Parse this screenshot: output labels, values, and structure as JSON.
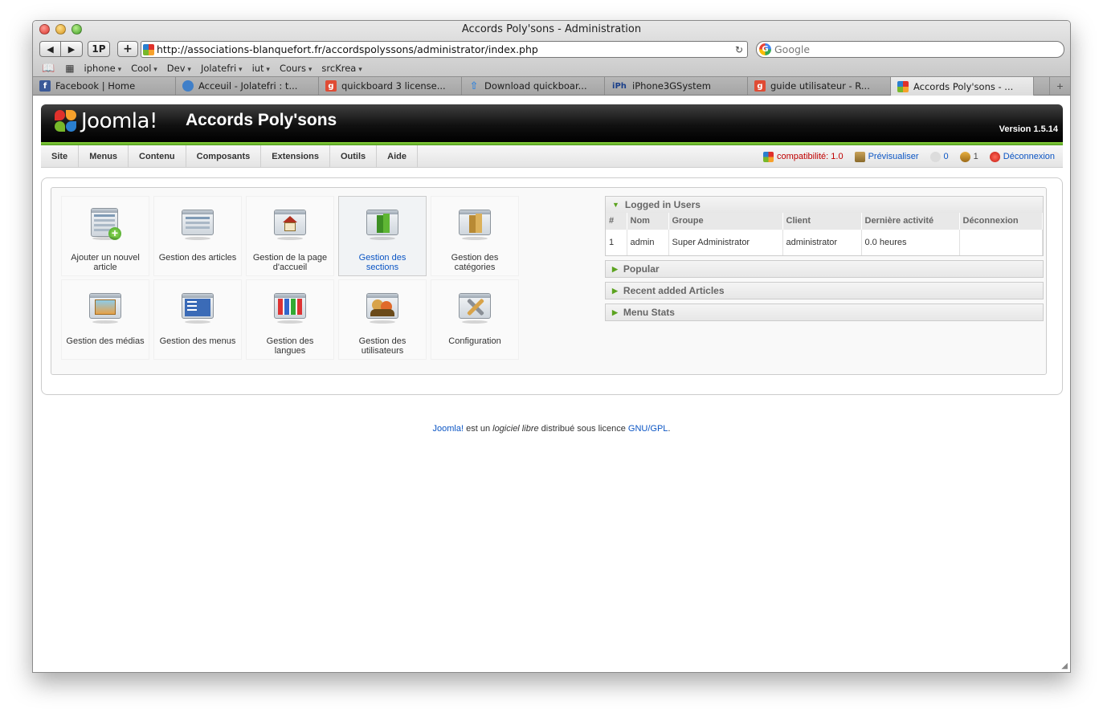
{
  "window": {
    "title": "Accords Poly'sons - Administration"
  },
  "toolbar": {
    "back": "◀",
    "forward": "▶",
    "onep": "1P",
    "add": "+",
    "url": "http://associations-blanquefort.fr/accordspolyssons/administrator/index.php",
    "reload": "↻",
    "search_placeholder": "Google"
  },
  "bookmarks": [
    "iphone",
    "Cool",
    "Dev",
    "Jolatefri",
    "iut",
    "Cours",
    "srcKrea"
  ],
  "tabs": [
    {
      "label": "Facebook | Home",
      "icon": "facebook-icon",
      "color": "#3b5998",
      "glyph": "f",
      "width": 178
    },
    {
      "label": "Acceuil - Jolatefri : t...",
      "icon": "globe-icon",
      "color": "#3f7fc9",
      "glyph": "",
      "width": 178
    },
    {
      "label": "quickboard 3 license...",
      "icon": "google-icon",
      "color": "#e04b34",
      "glyph": "g",
      "width": 178
    },
    {
      "label": "Download quickboar...",
      "icon": "arrow-up-icon",
      "color": "#3a86d9",
      "glyph": "⇧",
      "width": 178
    },
    {
      "label": "iPhone3GSystem",
      "icon": "iph-icon",
      "color": "#2a2a2a",
      "glyph": "iPh",
      "width": 178
    },
    {
      "label": "guide utilisateur - R...",
      "icon": "google-icon",
      "color": "#e04b34",
      "glyph": "g",
      "width": 178
    },
    {
      "label": "Accords Poly'sons - ...",
      "icon": "joomla-icon",
      "color": "#77b82a",
      "glyph": "",
      "width": 178,
      "active": true
    }
  ],
  "joomla": {
    "logo_text": "Joomla!",
    "site_name": "Accords Poly'sons",
    "version": "Version 1.5.14",
    "menu": [
      "Site",
      "Menus",
      "Contenu",
      "Composants",
      "Extensions",
      "Outils",
      "Aide"
    ],
    "status": {
      "compat": "compatibilité: 1.0",
      "preview": "Prévisualiser",
      "messages": "0",
      "users": "1",
      "logout": "Déconnexion"
    },
    "cpanel": [
      {
        "label": "Ajouter un nouvel article",
        "icon": "add-article-icon"
      },
      {
        "label": "Gestion des articles",
        "icon": "articles-icon"
      },
      {
        "label": "Gestion de la page d'accueil",
        "icon": "frontpage-icon"
      },
      {
        "label": "Gestion des sections",
        "icon": "sections-icon",
        "hover": true
      },
      {
        "label": "Gestion des catégories",
        "icon": "categories-icon"
      },
      {
        "label": "Gestion des médias",
        "icon": "media-icon"
      },
      {
        "label": "Gestion des menus",
        "icon": "menus-icon"
      },
      {
        "label": "Gestion des langues",
        "icon": "languages-icon"
      },
      {
        "label": "Gestion des utilisateurs",
        "icon": "users-icon"
      },
      {
        "label": "Configuration",
        "icon": "config-icon"
      }
    ],
    "logged_in": {
      "title": "Logged in Users",
      "columns": [
        "#",
        "Nom",
        "Groupe",
        "Client",
        "Dernière activité",
        "Déconnexion"
      ],
      "rows": [
        [
          "1",
          "admin",
          "Super Administrator",
          "administrator",
          "0.0 heures",
          ""
        ]
      ]
    },
    "modules": [
      "Popular",
      "Recent added Articles",
      "Menu Stats"
    ],
    "footer": {
      "joomla": "Joomla!",
      "text1": " est un ",
      "italic": "logiciel libre",
      "text2": " distribué sous licence ",
      "license": "GNU/GPL",
      "end": "."
    }
  },
  "colors": {
    "accent_green": "#77b82a",
    "link_blue": "#0b55c4",
    "header_black": "#111111",
    "compat_red": "#c00000"
  }
}
